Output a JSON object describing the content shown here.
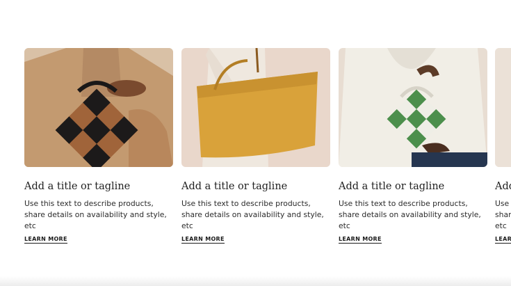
{
  "cards": [
    {
      "image_alt": "Hands holding a black and tan checkered woven handbag against a camel coat",
      "title": "Add a title or tagline",
      "description": "Use this text to describe products, share details on availability and style, etc",
      "link_label": "LEARN MORE"
    },
    {
      "image_alt": "Person carrying a mustard yellow leather tote bag on the shoulder",
      "title": "Add a title or tagline",
      "description": "Use this text to describe products, share details on availability and style, etc",
      "link_label": "LEARN MORE"
    },
    {
      "image_alt": "Person in white knit sweater holding a green and cream checkered handbag",
      "title": "Add a title or tagline",
      "description": "Use this text to describe products, share details on availability and style, etc",
      "link_label": "LEARN MORE"
    },
    {
      "image_alt": "Partially visible product image",
      "title": "Add a title or tagline",
      "description": "Use this text to describe products, share details on availability and style, etc",
      "link_label": "LEARN MORE"
    }
  ],
  "colors": {
    "camel_coat": "#c9a27a",
    "checker_dark": "#1c1a1a",
    "checker_tan": "#a0643a",
    "mustard_tote": "#d9a23a",
    "green_checker": "#4c8f4c",
    "cream": "#efeee6"
  }
}
